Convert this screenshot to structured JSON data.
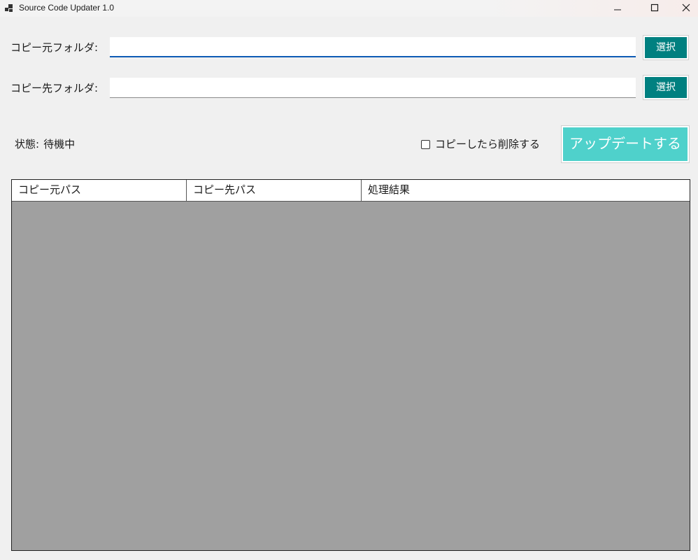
{
  "window": {
    "title": "Source Code Updater 1.0"
  },
  "form": {
    "source_label": "コピー元フォルダ:",
    "source_value": "",
    "dest_label": "コピー先フォルダ:",
    "dest_value": "",
    "select_label": "選択"
  },
  "status": {
    "label": "状態:",
    "value": "待機中"
  },
  "options": {
    "delete_after_copy_label": "コピーしたら削除する",
    "delete_after_copy_checked": false
  },
  "actions": {
    "update_label": "アップデートする"
  },
  "grid": {
    "columns": [
      "コピー元パス",
      "コピー先パス",
      "処理結果"
    ],
    "rows": []
  },
  "colors": {
    "select_button": "#008080",
    "update_button": "#4fd1cb",
    "focus_underline": "#0d5bb5",
    "grid_background": "#a0a0a0"
  }
}
